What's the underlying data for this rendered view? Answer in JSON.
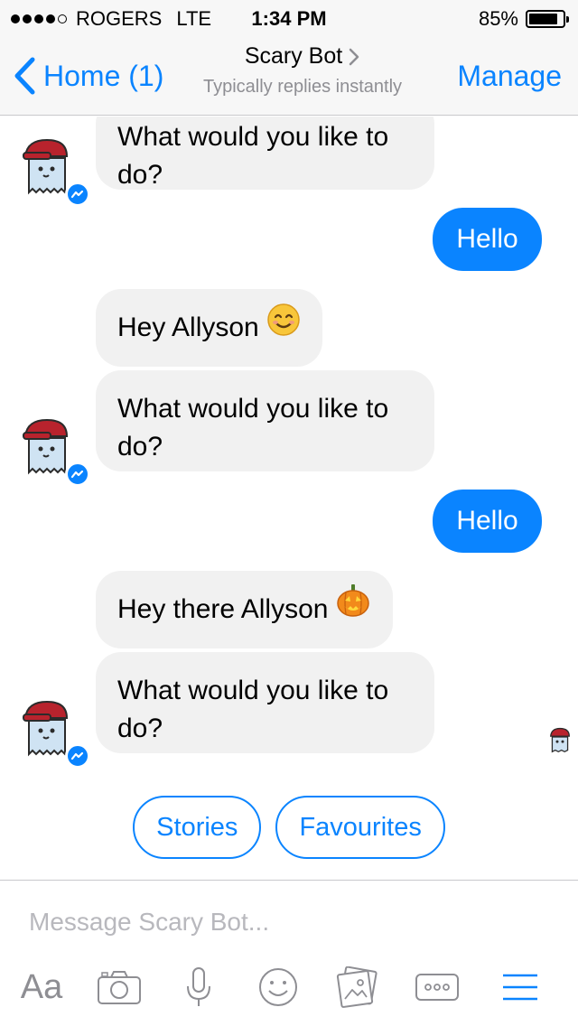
{
  "status_bar": {
    "carrier": "ROGERS",
    "network": "LTE",
    "time": "1:34 PM",
    "battery_percent": "85%",
    "battery_level": 0.85,
    "signal_dots_filled": 4,
    "signal_dots_total": 5
  },
  "nav": {
    "back_label": "Home (1)",
    "title": "Scary Bot",
    "subtitle": "Typically replies instantly",
    "manage_label": "Manage"
  },
  "messages": [
    {
      "sender": "bot",
      "text": "What would you like to do?"
    },
    {
      "sender": "user",
      "text": "Hello"
    },
    {
      "sender": "bot",
      "text": "Hey Allyson",
      "emoji": "smiling-face-icon"
    },
    {
      "sender": "bot",
      "text": "What would you like to do?"
    },
    {
      "sender": "user",
      "text": "Hello"
    },
    {
      "sender": "bot",
      "text": "Hey there Allyson",
      "emoji": "jack-o-lantern-icon"
    },
    {
      "sender": "bot",
      "text": "What would you like to do?"
    }
  ],
  "quick_replies": [
    {
      "label": "Stories"
    },
    {
      "label": "Favourites"
    }
  ],
  "composer": {
    "placeholder": "Message Scary Bot...",
    "aa_label": "Aa",
    "tools": [
      "text-format-icon",
      "camera-icon",
      "microphone-icon",
      "emoji-icon",
      "gallery-icon",
      "more-icon",
      "menu-icon"
    ]
  },
  "colors": {
    "accent": "#0a84ff",
    "bot_bubble": "#f1f1f1",
    "muted": "#8e8e93",
    "ghost_cap": "#b8232d",
    "ghost_body": "#cfe3f3"
  }
}
